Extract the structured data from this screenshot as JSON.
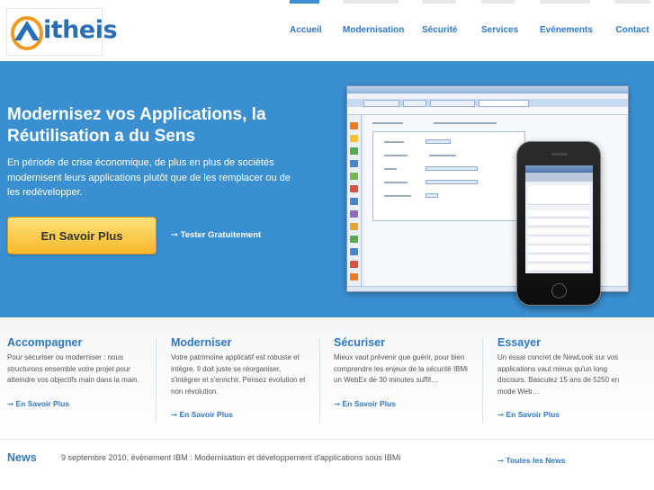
{
  "brand": {
    "name": "itheis"
  },
  "nav": {
    "items": [
      {
        "label": "Accueil"
      },
      {
        "label": "Modernisation"
      },
      {
        "label": "Sécurité"
      },
      {
        "label": "Services"
      },
      {
        "label": "Evénements"
      },
      {
        "label": "Contact"
      }
    ]
  },
  "hero": {
    "title": "Modernisez vos Applications, la Réutilisation a du Sens",
    "text": "En période de crise économique, de plus en plus de sociétés modernisent leurs applications plutôt que de les remplacer ou de les redévelopper.",
    "cta_label": "En Savoir Plus",
    "secondary_link": "➞ Tester Gratuitement"
  },
  "features": [
    {
      "title": "Accompagner",
      "text": "Pour sécuriser ou moderniser : nous structurons ensemble votre projet pour atteindre vos objectifs main dans la main.",
      "link": "➞ En Savoir Plus"
    },
    {
      "title": "Moderniser",
      "text": "Votre patrimoine applicatif est robuste et intègre. Il doit juste se réorganiser, s'intégrer et s'enrichir. Pensez évolution et non révolution.",
      "link": "➞ En Savoir Plus"
    },
    {
      "title": "Sécuriser",
      "text": "Mieux vaut prévenir que guérir, pour bien comprendre les enjeux de la sécurité IBMi un WebEx de 30 minutes suffit…",
      "link": "➞ En Savoir Plus"
    },
    {
      "title": "Essayer",
      "text": "Un essai concret de NewLook sur vos applications vaut mieux qu'un long discours. Basculez 15 ans de 5250 en mode Web…",
      "link": "➞ En Savoir Plus"
    }
  ],
  "news": {
    "label": "News",
    "item": "9 septembre 2010, évènement IBM : Modernisation et développement d'applications sous IBMi",
    "all_link": "➞ Toutes les News"
  },
  "colors": {
    "accent": "#2f78c4",
    "hero_bg": "#3a8fd1",
    "cta": "#f7b92a"
  }
}
